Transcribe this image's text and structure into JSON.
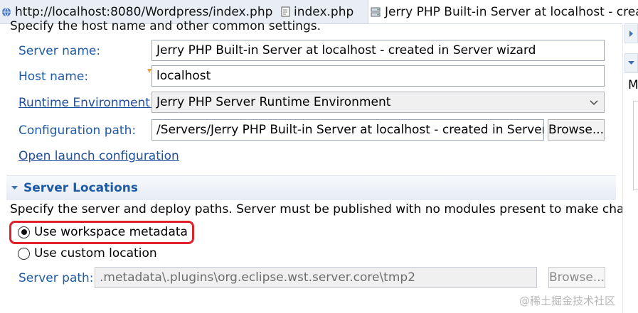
{
  "tabs": [
    {
      "label": "http://localhost:8080/Wordpress/index.php",
      "icon": "globe-icon"
    },
    {
      "label": "index.php",
      "icon": "php-file-icon"
    },
    {
      "label": "Jerry PHP Built-in Server at localhost - created in Server wizard",
      "icon": "server-icon"
    }
  ],
  "general": {
    "description_clip": "Specify the host name and other common settings.",
    "server_name_label": "Server name:",
    "server_name_value": "Jerry PHP Built-in Server at localhost - created in Server wizard",
    "host_name_label": "Host name:",
    "host_name_value": "localhost",
    "runtime_label": "Runtime Environment:",
    "runtime_value": "Jerry PHP Server Runtime Environment",
    "config_path_label": "Configuration path:",
    "config_path_value": "/Servers/Jerry PHP Built-in Server at localhost - created in Server wizard",
    "browse_label": "Browse...",
    "open_launch_label": "Open launch configuration"
  },
  "locations": {
    "title": "Server Locations",
    "description": "Specify the server and deploy paths. Server must be published with no modules present to make changes.",
    "option_workspace": "Use workspace metadata",
    "option_custom": "Use custom location",
    "selected": "Use workspace metadata",
    "server_path_label": "Server path:",
    "server_path_value": ".metadata\\.plugins\\org.eclipse.wst.server.core\\tmp2",
    "browse_label": "Browse..."
  },
  "side": {
    "letter": "M"
  },
  "watermark": "@稀土掘金技术社区",
  "colors": {
    "link": "#1f5aa3",
    "highlight": "#e0202a",
    "section_bg": "#e6ecf4"
  }
}
